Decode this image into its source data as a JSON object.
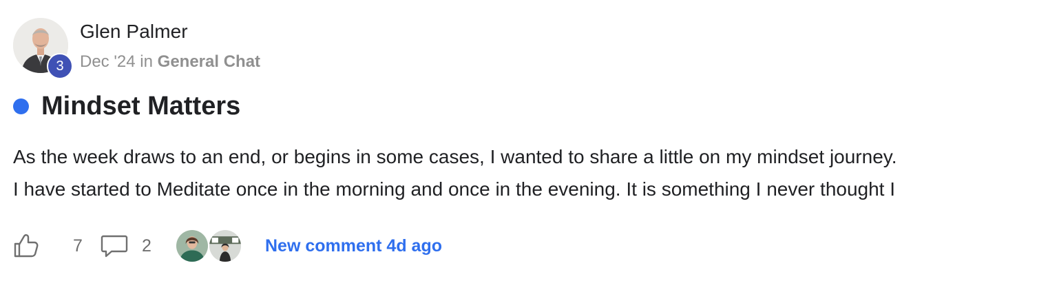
{
  "author": {
    "name": "Glen Palmer",
    "level": "3",
    "avatar_icon": "user-avatar-photo"
  },
  "meta": {
    "date": "Dec '24",
    "in_label": "in",
    "category": "General Chat"
  },
  "post": {
    "title": "Mindset Matters",
    "unread": true,
    "excerpt_lines": [
      "As the week draws to an end, or begins in some cases, I wanted to share a little on my mindset journey.",
      "I have started to Meditate once in the morning and once in the evening. It is something I never thought I"
    ]
  },
  "footer": {
    "likes": "7",
    "comments": "2",
    "like_icon": "thumbs-up-icon",
    "comment_icon": "speech-bubble-icon",
    "new_comment": "New comment 4d ago"
  },
  "colors": {
    "accent": "#2f6fee",
    "level_badge": "#3f51b5",
    "muted": "#909090",
    "text": "#202124"
  }
}
